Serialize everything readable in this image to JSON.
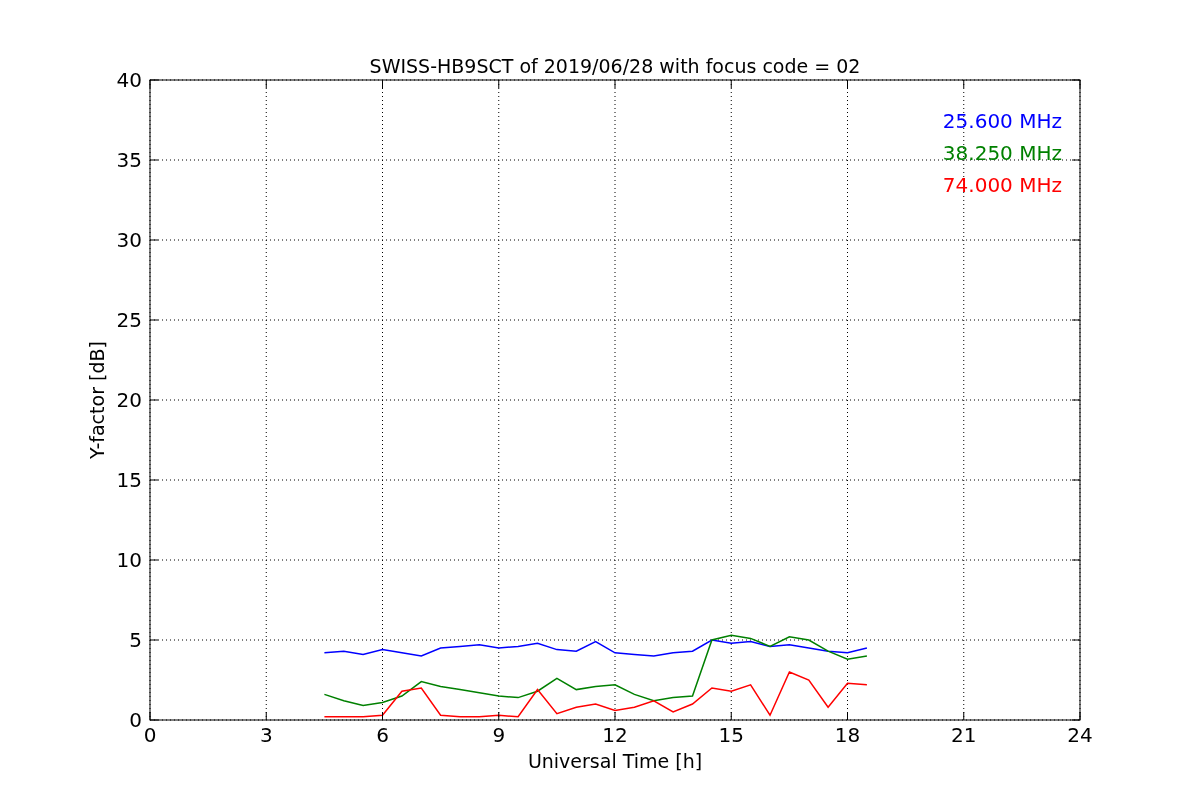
{
  "chart_data": {
    "type": "line",
    "title": "SWISS-HB9SCT of 2019/06/28 with focus code = 02",
    "xlabel": "Universal Time [h]",
    "ylabel": "Y-factor [dB]",
    "x": [
      4.5,
      5,
      5.5,
      6,
      6.5,
      7,
      7.5,
      8,
      8.5,
      9,
      9.5,
      10,
      10.5,
      11,
      11.5,
      12,
      12.5,
      13,
      13.5,
      14,
      14.5,
      15,
      15.5,
      16,
      16.5,
      17,
      17.5,
      18,
      18.5
    ],
    "series": [
      {
        "name": "25.600 MHz",
        "color": "#0000ff",
        "values": [
          4.2,
          4.3,
          4.1,
          4.4,
          4.2,
          4.0,
          4.5,
          4.6,
          4.7,
          4.5,
          4.6,
          4.8,
          4.4,
          4.3,
          4.9,
          4.2,
          4.1,
          4.0,
          4.2,
          4.3,
          5.0,
          4.8,
          4.9,
          4.6,
          4.7,
          4.5,
          4.3,
          4.2,
          4.5
        ]
      },
      {
        "name": "38.250 MHz",
        "color": "#008000",
        "values": [
          1.6,
          1.2,
          0.9,
          1.1,
          1.5,
          2.4,
          2.1,
          1.9,
          1.7,
          1.5,
          1.4,
          1.8,
          2.6,
          1.9,
          2.1,
          2.2,
          1.6,
          1.2,
          1.4,
          1.5,
          5.0,
          5.3,
          5.1,
          4.6,
          5.2,
          5.0,
          4.3,
          3.8,
          4.0
        ]
      },
      {
        "name": "74.000 MHz",
        "color": "#ff0000",
        "values": [
          0.2,
          0.2,
          0.2,
          0.3,
          1.8,
          2.0,
          0.3,
          0.2,
          0.2,
          0.3,
          0.2,
          1.9,
          0.4,
          0.8,
          1.0,
          0.6,
          0.8,
          1.2,
          0.5,
          1.0,
          2.0,
          1.8,
          2.2,
          0.3,
          3.0,
          2.5,
          0.8,
          2.3,
          2.2
        ]
      }
    ],
    "grid": true,
    "xlim": [
      0,
      24
    ],
    "ylim": [
      0,
      40
    ],
    "xticks": [
      0,
      3,
      6,
      9,
      12,
      15,
      18,
      21,
      24
    ],
    "yticks": [
      0,
      5,
      10,
      15,
      20,
      25,
      30,
      35,
      40
    ]
  }
}
